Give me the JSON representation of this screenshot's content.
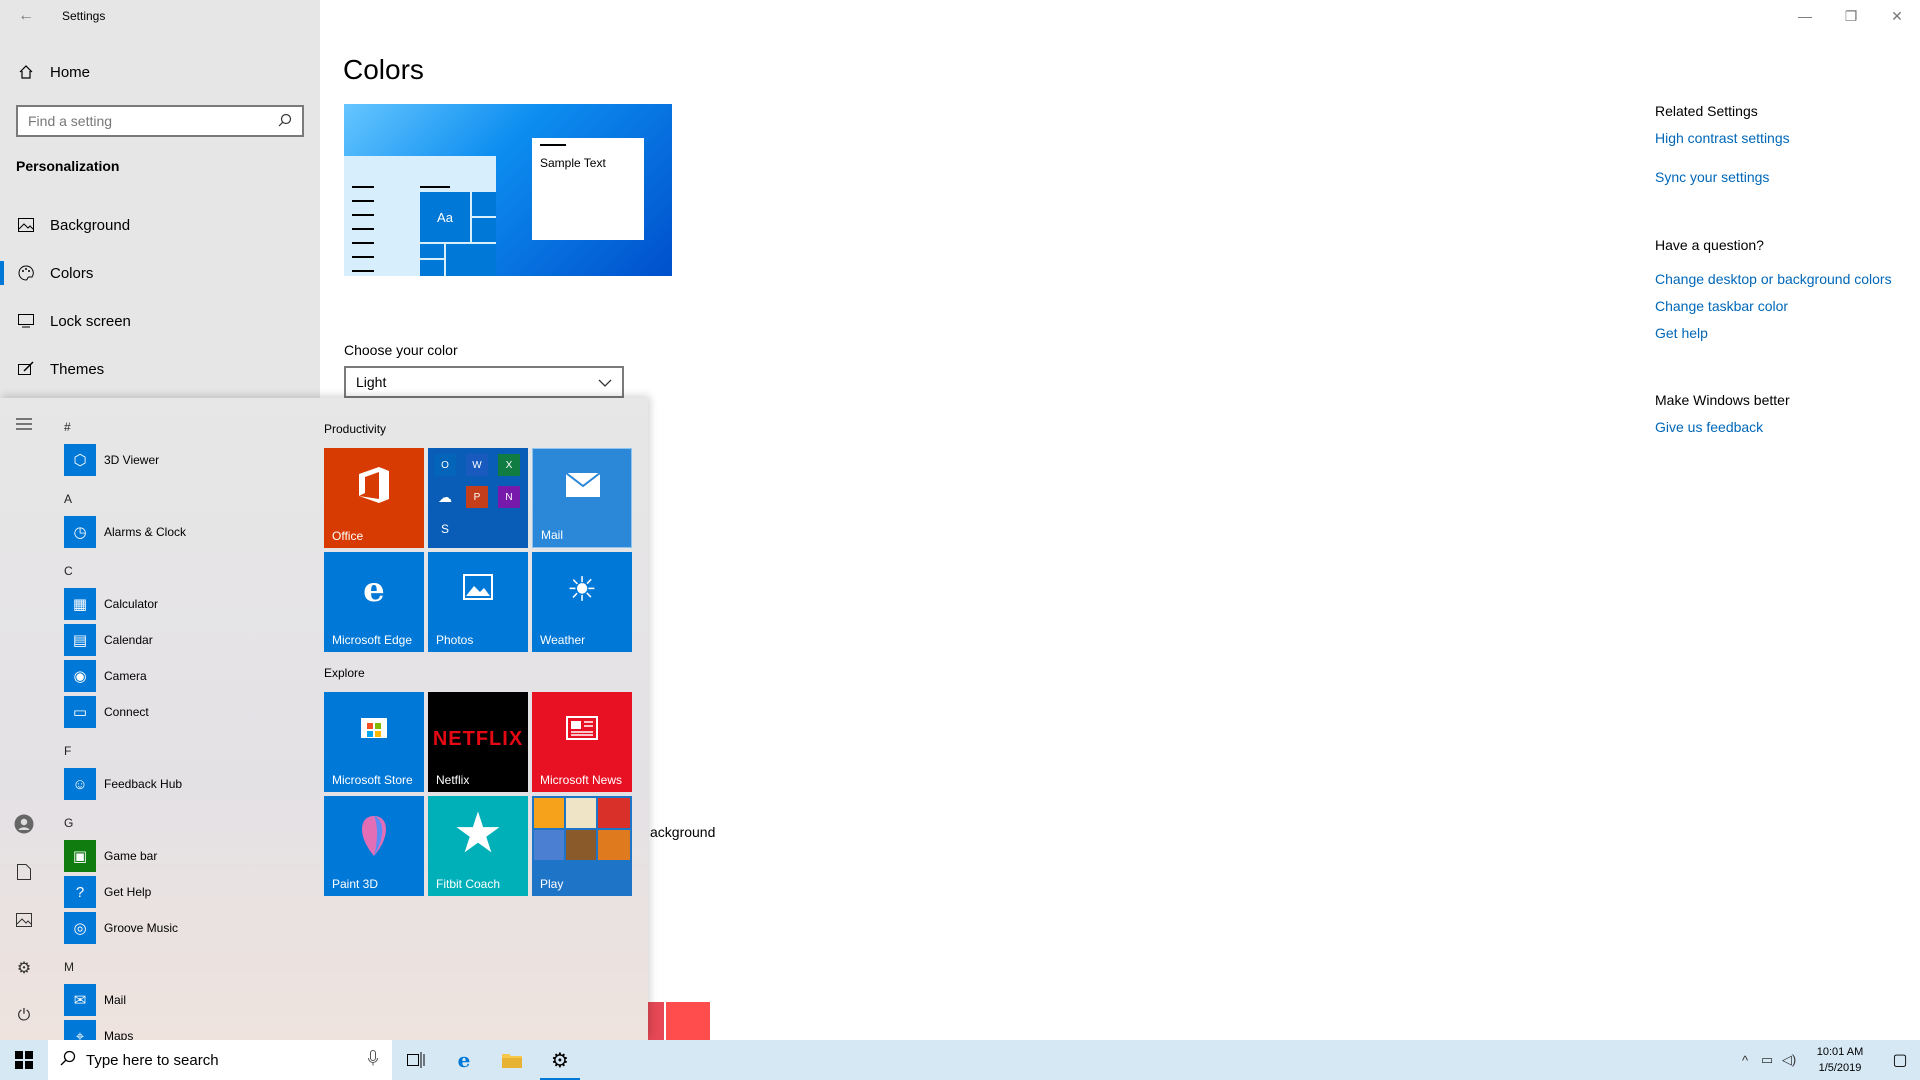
{
  "window": {
    "title": "Settings",
    "controls": {
      "minimize": "—",
      "maximize": "❐",
      "close": "✕"
    }
  },
  "sidebar": {
    "home_label": "Home",
    "search_placeholder": "Find a setting",
    "section": "Personalization",
    "items": [
      {
        "label": "Background",
        "icon": "image-icon"
      },
      {
        "label": "Colors",
        "icon": "palette-icon",
        "active": true
      },
      {
        "label": "Lock screen",
        "icon": "lock-screen-icon"
      },
      {
        "label": "Themes",
        "icon": "brush-icon"
      }
    ]
  },
  "main": {
    "title": "Colors",
    "preview_sample_text": "Sample Text",
    "preview_tile_text": "Aa",
    "choose_label": "Choose your color",
    "choose_value": "Light",
    "partial_text": "ackground"
  },
  "related": {
    "heading": "Related Settings",
    "links": [
      "High contrast settings",
      "Sync your settings"
    ],
    "question_heading": "Have a question?",
    "question_links": [
      "Change desktop or background colors",
      "Change taskbar color",
      "Get help"
    ],
    "better_heading": "Make Windows better",
    "better_link": "Give us feedback"
  },
  "start_menu": {
    "app_list": [
      {
        "type": "letter",
        "text": "#"
      },
      {
        "type": "app",
        "text": "3D Viewer",
        "icon": "cube-icon"
      },
      {
        "type": "letter",
        "text": "A"
      },
      {
        "type": "app",
        "text": "Alarms & Clock",
        "icon": "clock-icon"
      },
      {
        "type": "letter",
        "text": "C"
      },
      {
        "type": "app",
        "text": "Calculator",
        "icon": "calculator-icon"
      },
      {
        "type": "app",
        "text": "Calendar",
        "icon": "calendar-icon"
      },
      {
        "type": "app",
        "text": "Camera",
        "icon": "camera-icon"
      },
      {
        "type": "app",
        "text": "Connect",
        "icon": "connect-icon"
      },
      {
        "type": "letter",
        "text": "F"
      },
      {
        "type": "app",
        "text": "Feedback Hub",
        "icon": "feedback-icon"
      },
      {
        "type": "letter",
        "text": "G"
      },
      {
        "type": "app",
        "text": "Game bar",
        "icon": "xbox-icon"
      },
      {
        "type": "app",
        "text": "Get Help",
        "icon": "help-icon"
      },
      {
        "type": "app",
        "text": "Groove Music",
        "icon": "music-icon"
      },
      {
        "type": "letter",
        "text": "M"
      },
      {
        "type": "app",
        "text": "Mail",
        "icon": "mail-icon"
      },
      {
        "type": "app",
        "text": "Maps",
        "icon": "map-icon"
      }
    ],
    "groups": [
      {
        "label": "Productivity",
        "tiles": [
          {
            "label": "Office",
            "color": "#d83b01",
            "icon": "office-icon"
          },
          {
            "label": "",
            "color": "#0a5db7",
            "icon": "office-apps-icon"
          },
          {
            "label": "Mail",
            "color": "#2b88d8",
            "icon": "mail-icon"
          },
          {
            "label": "Microsoft Edge",
            "color": "#0078d7",
            "icon": "edge-icon"
          },
          {
            "label": "Photos",
            "color": "#0078d7",
            "icon": "photos-icon"
          },
          {
            "label": "Weather",
            "color": "#0078d7",
            "icon": "sun-icon"
          }
        ]
      },
      {
        "label": "Explore",
        "tiles": [
          {
            "label": "Microsoft Store",
            "color": "#0078d7",
            "icon": "store-icon"
          },
          {
            "label": "Netflix",
            "color": "#000000",
            "icon": "netflix-icon",
            "logo": "NETFLIX"
          },
          {
            "label": "Microsoft News",
            "color": "#e81123",
            "icon": "news-icon"
          },
          {
            "label": "Paint 3D",
            "color": "#0078d7",
            "icon": "paint3d-icon"
          },
          {
            "label": "Fitbit Coach",
            "color": "#00b0b9",
            "icon": "star-icon"
          },
          {
            "label": "Play",
            "color": "#1e74c6",
            "icon": "games-icon"
          }
        ]
      }
    ]
  },
  "taskbar": {
    "search_placeholder": "Type here to search",
    "time": "10:01 AM",
    "date": "1/5/2019"
  },
  "colors": {
    "accent": "#0078d7",
    "link": "#0067b8",
    "swatch_dark": "#e74856",
    "swatch_light": "#ff4d4d"
  }
}
